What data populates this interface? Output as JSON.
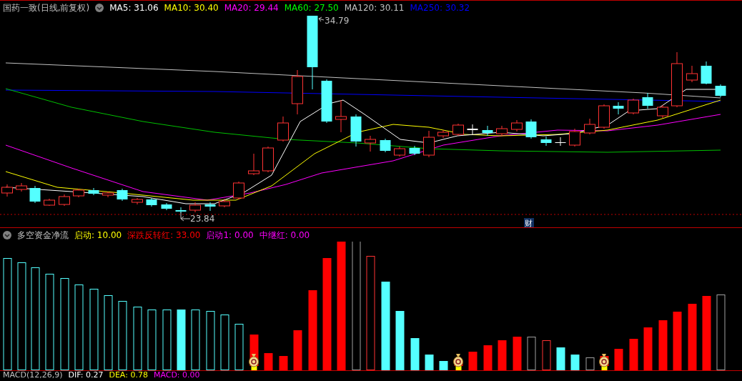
{
  "main_panel": {
    "title": "国药一致(日线,前复权)",
    "indicators": [
      {
        "label": "MA5: 31.06",
        "color": "#ffffff"
      },
      {
        "label": "MA10: 30.40",
        "color": "#ffff00"
      },
      {
        "label": "MA20: 29.44",
        "color": "#ff00ff"
      },
      {
        "label": "MA60: 27.50",
        "color": "#00ff00"
      },
      {
        "label": "MA120: 30.11",
        "color": "#c0c0c0"
      },
      {
        "label": "MA250: 30.32",
        "color": "#0000ff"
      }
    ],
    "high_label": "34.79",
    "low_label": "23.84",
    "marker_label": "财"
  },
  "indicator_panel": {
    "title": "多空资金净流",
    "indicators": [
      {
        "label": "启动: 10.00",
        "color": "#ffff00"
      },
      {
        "label": "深跌反转红: 33.00",
        "color": "#ff0000"
      },
      {
        "label": "启动1: 0.00",
        "color": "#ff00ff"
      },
      {
        "label": "中继红: 0.00",
        "color": "#ff00ff"
      }
    ]
  },
  "macd_panel": {
    "title": "MACD(12,26,9)",
    "indicators": [
      {
        "label": "DIF: 0.27",
        "color": "#ffffff"
      },
      {
        "label": "DEA: 0.78",
        "color": "#ffff00"
      },
      {
        "label": "MACD: 0.00",
        "color": "#ff00ff"
      }
    ]
  }
}
